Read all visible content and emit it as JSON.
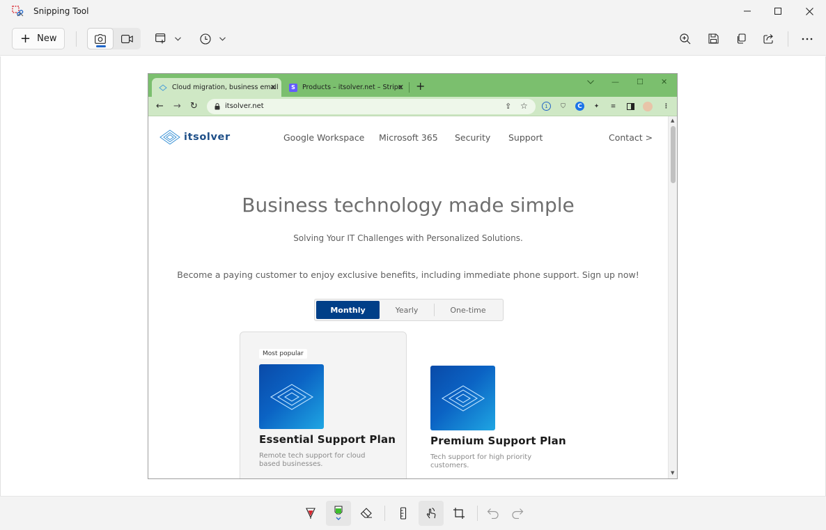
{
  "app": {
    "title": "Snipping Tool",
    "new_label": "New",
    "accent": "#1f66c9"
  },
  "toolbar": {
    "left_icons": [
      "camera-icon",
      "video-icon",
      "snip-shape-icon",
      "delay-timer-icon"
    ],
    "right_icons": [
      "zoom-in-icon",
      "save-icon",
      "copy-icon",
      "share-icon",
      "more-icon"
    ]
  },
  "bottom_tools": [
    "ballpoint-pen-icon",
    "highlighter-icon",
    "eraser-icon",
    "ruler-icon",
    "touch-writing-icon",
    "crop-icon",
    "undo-icon",
    "redo-icon"
  ],
  "browser": {
    "tabs": [
      {
        "title": "Cloud migration, business email",
        "active": true
      },
      {
        "title": "Products – itsolver.net – Stripe",
        "active": false,
        "favicon_letter": "S"
      }
    ],
    "url": "itsolver.net",
    "theme_color": "#7bbf6e"
  },
  "site": {
    "logo_text": "itsolver",
    "nav": [
      "Google Workspace",
      "Microsoft 365",
      "Security",
      "Support"
    ],
    "contact": "Contact >",
    "hero_title": "Business technology made simple",
    "hero_subtitle": "Solving Your IT Challenges with Personalized Solutions.",
    "promo": "Become a paying customer to enjoy exclusive benefits, including immediate phone support. Sign up now!",
    "billing": {
      "options": [
        "Monthly",
        "Yearly",
        "One-time"
      ],
      "selected": "Monthly",
      "selected_color": "#003f88"
    },
    "plans": [
      {
        "badge": "Most popular",
        "name": "Essential Support Plan",
        "desc": "Remote tech support for cloud based businesses."
      },
      {
        "name": "Premium Support Plan",
        "desc": "Tech support for high priority customers."
      }
    ]
  }
}
